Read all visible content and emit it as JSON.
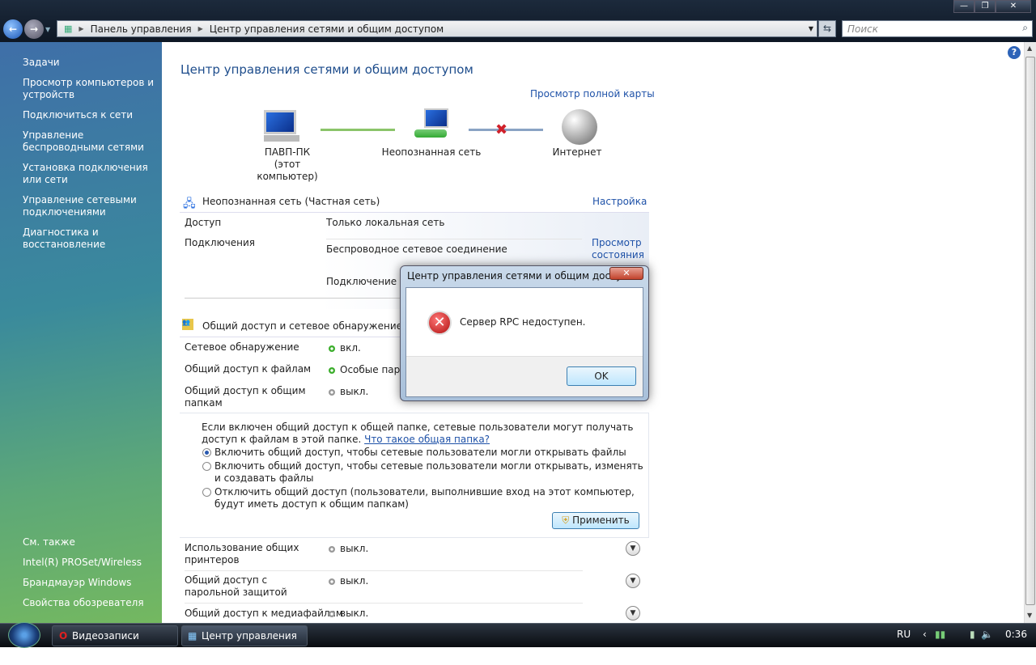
{
  "window": {
    "minimize": "—",
    "maximize": "❐",
    "close": "✕"
  },
  "address": {
    "crumbs": [
      "Панель управления",
      "Центр управления сетями и общим доступом"
    ],
    "search_placeholder": "Поиск"
  },
  "sidebar": {
    "tasks_title": "Задачи",
    "items": [
      "Просмотр компьютеров и устройств",
      "Подключиться к сети",
      "Управление беспроводными сетями",
      "Установка подключения или сети",
      "Управление сетевыми подключениями",
      "Диагностика и восстановление"
    ],
    "see_also_title": "См. также",
    "see_also": [
      "Intel(R) PROSet/Wireless",
      "Брандмауэр Windows",
      "Свойства обозревателя"
    ]
  },
  "main": {
    "title": "Центр управления сетями и общим доступом",
    "full_map": "Просмотр полной карты",
    "map": {
      "computer": "ПАВП-ПК",
      "computer_sub": "(этот компьютер)",
      "network": "Неопознанная сеть",
      "internet": "Интернет"
    },
    "network": {
      "name": "Неопознанная сеть (Частная сеть)",
      "customize": "Настройка",
      "access_label": "Доступ",
      "access_value": "Только локальная сеть",
      "connections_label": "Подключения",
      "conn1": "Беспроводное сетевое соединение",
      "conn1_link": "Просмотр состояния",
      "conn2": "Подключение по"
    },
    "sharing": {
      "title": "Общий доступ и сетевое обнаружение",
      "rows": [
        {
          "label": "Сетевое обнаружение",
          "value": "вкл.",
          "status": "on"
        },
        {
          "label": "Общий доступ к файлам",
          "value": "Особые пара",
          "status": "on"
        },
        {
          "label": "Общий доступ к общим папкам",
          "value": "выкл.",
          "status": "off"
        }
      ],
      "public_desc": "Если включен общий доступ к общей папке, сетевые пользователи могут получать доступ к файлам в этой папке.",
      "public_link": "Что такое общая папка?",
      "options": [
        {
          "label": "Включить общий доступ, чтобы сетевые пользователи могли открывать файлы",
          "selected": true
        },
        {
          "label": "Включить общий доступ, чтобы сетевые пользователи могли открывать, изменять и создавать файлы",
          "selected": false
        },
        {
          "label": "Отключить общий доступ (пользователи, выполнившие вход на этот компьютер, будут иметь доступ к общим папкам)",
          "selected": false
        }
      ],
      "apply": "Применить",
      "more_rows": [
        {
          "label": "Использование общих принтеров",
          "value": "выкл."
        },
        {
          "label": "Общий доступ с парольной защитой",
          "value": "выкл."
        },
        {
          "label": "Общий доступ к медиафайлам",
          "value": "выкл."
        }
      ]
    }
  },
  "dialog": {
    "title": "Центр управления сетями и общим доступ...",
    "message": "Сервер RPC недоступен.",
    "ok": "OK"
  },
  "taskbar": {
    "items": [
      "Видеозаписи ====...",
      "Центр управления ..."
    ],
    "lang": "RU",
    "time": "0:36"
  }
}
